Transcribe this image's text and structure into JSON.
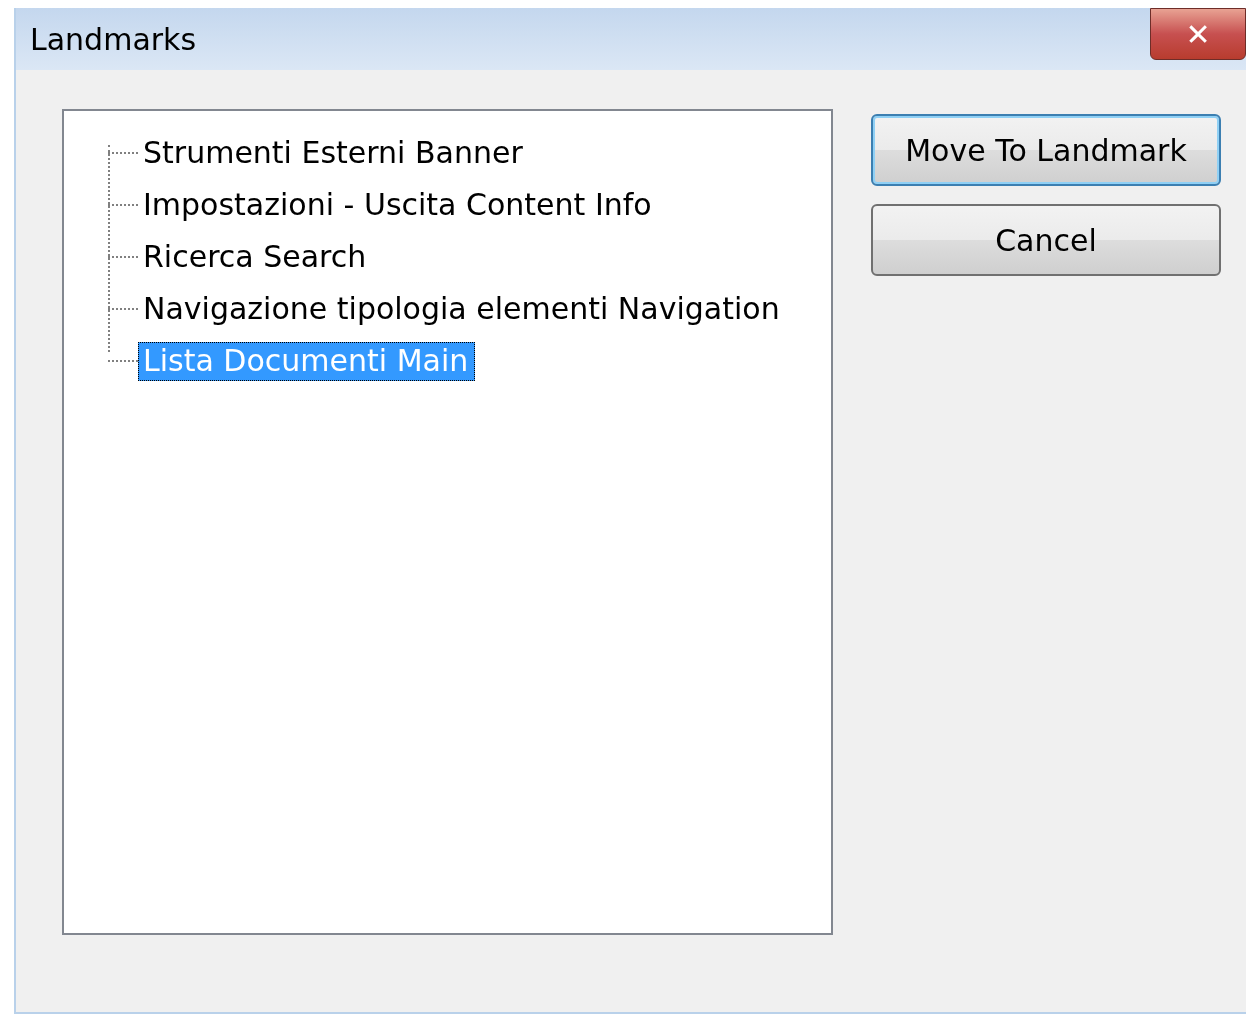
{
  "window": {
    "title": "Landmarks",
    "close_label": "✕"
  },
  "tree": {
    "items": [
      {
        "label": "Strumenti Esterni Banner",
        "selected": false
      },
      {
        "label": "Impostazioni - Uscita Content Info",
        "selected": false
      },
      {
        "label": "Ricerca Search",
        "selected": false
      },
      {
        "label": "Navigazione tipologia elementi Navigation",
        "selected": false
      },
      {
        "label": "Lista Documenti Main",
        "selected": true
      }
    ]
  },
  "buttons": [
    {
      "label": "Move To Landmark",
      "default": true
    },
    {
      "label": "Cancel",
      "default": false
    }
  ]
}
